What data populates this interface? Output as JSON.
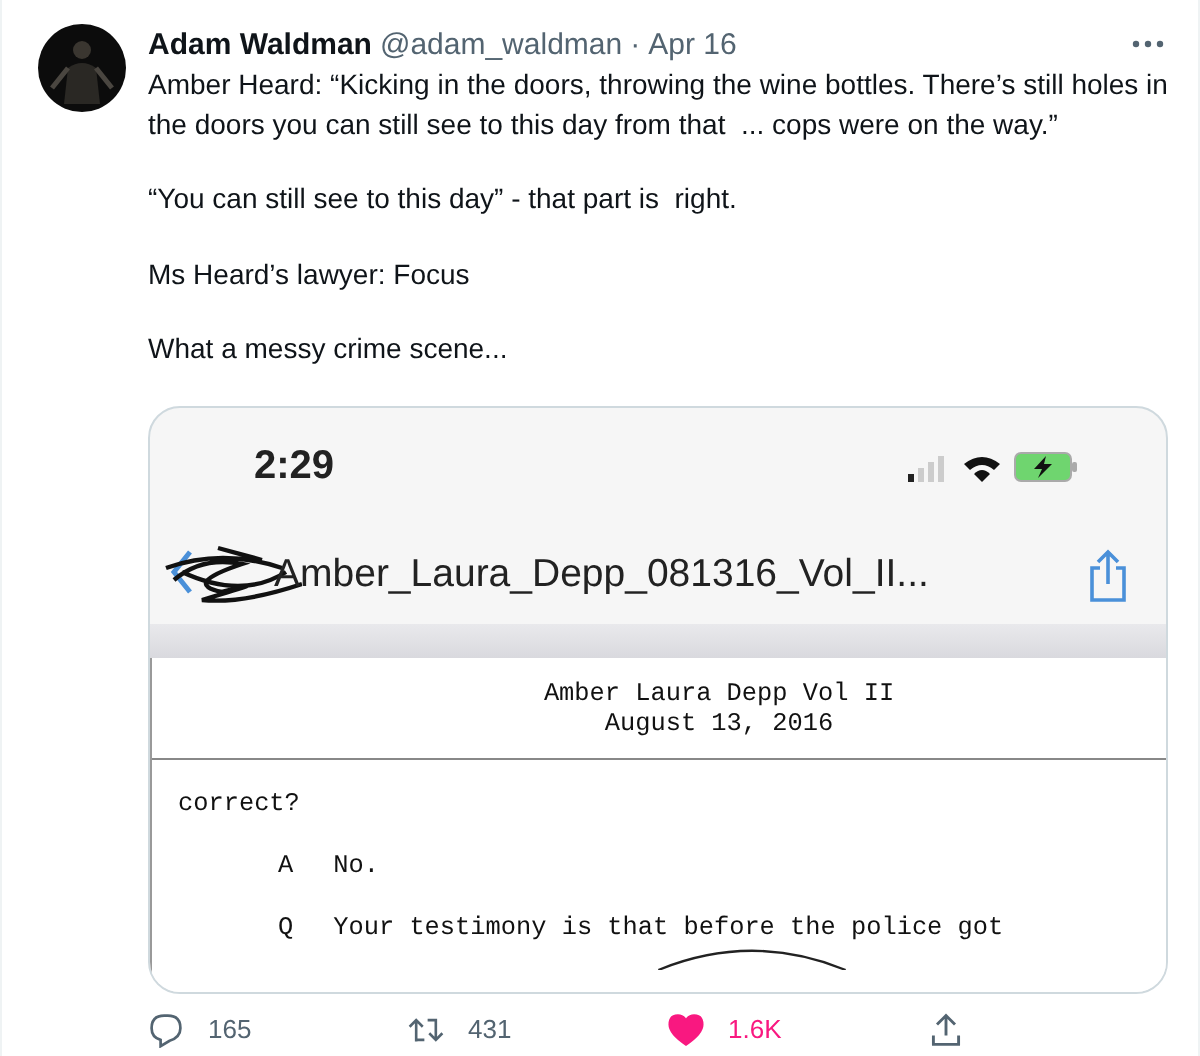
{
  "tweet": {
    "author": {
      "name": "Adam Waldman",
      "handle": "@adam_waldman",
      "separator": "·",
      "date": "Apr 16"
    },
    "paragraphs": [
      "Amber Heard: “Kicking in the doors, throwing the wine bottles. There’s still holes in the doors you can still see to this day from that  ... cops were on the way.”",
      "“You can still see to this day” - that part is  right.",
      "Ms Heard’s lawyer: Focus",
      "What a messy crime scene..."
    ],
    "media": {
      "status_bar": {
        "time": "2:29"
      },
      "nav_bar": {
        "title": "Amber_Laura_Depp_081316_Vol_II..."
      },
      "document": {
        "header": [
          "Amber Laura Depp Vol II",
          "August 13, 2016"
        ],
        "lines": [
          {
            "kind": "text",
            "text": "correct?"
          },
          {
            "kind": "qa",
            "speaker": "A",
            "text": "No."
          },
          {
            "kind": "qa",
            "speaker": "Q",
            "text": "Your testimony is that before the police got"
          }
        ]
      }
    },
    "actions": [
      {
        "kind": "reply",
        "count": "165",
        "active": false
      },
      {
        "kind": "retweet",
        "count": "431",
        "active": false
      },
      {
        "kind": "like",
        "count": "1.6K",
        "active": true
      },
      {
        "kind": "share",
        "active": false
      }
    ]
  }
}
